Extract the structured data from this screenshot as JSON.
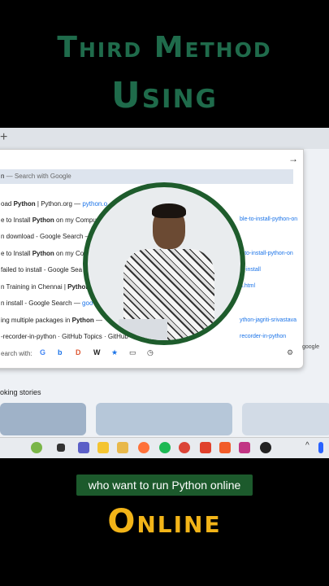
{
  "overlay": {
    "title_line1": "Third Method",
    "title_line2": "Using",
    "caption": "who want to run Python online",
    "title_line3": "Online"
  },
  "browser": {
    "new_tab_symbol": "+",
    "go_arrow": "→",
    "suggestions": [
      {
        "pre": "n",
        "bold": "",
        "post": " — Search with Google",
        "link": ""
      },
      {
        "pre": "oad ",
        "bold": "Python",
        "post": " | Python.org — ",
        "link": "python.o"
      },
      {
        "pre": "e to Install ",
        "bold": "Python",
        "post": " on my Compu",
        "link": ""
      },
      {
        "pre": "n download - Google Search — ",
        "bold": "",
        "post": "",
        "link": "go"
      },
      {
        "pre": "e to Install ",
        "bold": "Python",
        "post": " on my Co",
        "link": ""
      },
      {
        "pre": " failed to install - Google Sea",
        "bold": "",
        "post": "",
        "link": ""
      },
      {
        "pre": "n Training in Chennai | ",
        "bold": "Python",
        "post": "",
        "link": ""
      },
      {
        "pre": "n install - Google Search — ",
        "bold": "",
        "post": "",
        "link": "goo"
      },
      {
        "pre": "ing multiple packages in ",
        "bold": "Python",
        "post": " — ",
        "link": ""
      },
      {
        "pre": "-recorder-in-python",
        "bold": "",
        "post": " · GitHub Topics · GitHub",
        "link": ""
      }
    ],
    "right_links": [
      "ble-to-install-python-on",
      "n-to-install-python-on",
      "n+install",
      "ython-jagriti-srivastava",
      "n.html",
      "recorder-in-python"
    ],
    "search_with_label": "earch with:",
    "search_engines": [
      "G",
      "b",
      "D",
      "W",
      "★",
      "▭",
      "◷"
    ],
    "settings_icon": "⚙",
    "section_title": "oking stories",
    "google_label": "google",
    "taskbar_sym": "^"
  },
  "colors": {
    "title_green": "#1f6b4b",
    "caption_bg": "#1c5a2c",
    "online_yellow": "#f2b418",
    "ring": "#1e5c2c"
  }
}
